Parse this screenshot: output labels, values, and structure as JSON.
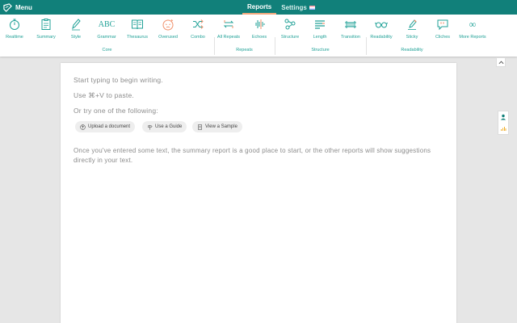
{
  "topbar": {
    "menu_label": "Menu",
    "tabs": [
      {
        "label": "Reports",
        "active": true
      },
      {
        "label": "Settings",
        "active": false
      }
    ]
  },
  "toolbar": {
    "tools": [
      {
        "label": "Realtime",
        "icon": "stopwatch-icon"
      },
      {
        "label": "Summary",
        "icon": "clipboard-icon"
      },
      {
        "label": "Style",
        "icon": "pen-icon"
      },
      {
        "label": "Grammar",
        "icon": "abc-icon",
        "glyph": "ABC"
      },
      {
        "label": "Thesaurus",
        "icon": "book-icon"
      },
      {
        "label": "Overused",
        "icon": "tired-face-icon"
      },
      {
        "label": "Combo",
        "icon": "shuffle-icon"
      },
      {
        "label": "All Repeats",
        "icon": "repeat-icon"
      },
      {
        "label": "Echoes",
        "icon": "sound-wave-icon"
      },
      {
        "label": "Structure",
        "icon": "structure-icon"
      },
      {
        "label": "Length",
        "icon": "length-icon"
      },
      {
        "label": "Transition",
        "icon": "bridge-icon"
      },
      {
        "label": "Readability",
        "icon": "glasses-icon"
      },
      {
        "label": "Sticky",
        "icon": "sticky-pen-icon"
      },
      {
        "label": "Cliches",
        "icon": "speech-bubble-icon"
      },
      {
        "label": "More Reports",
        "icon": "more-icon",
        "glyph": "∞"
      }
    ],
    "groups": [
      {
        "label": "Core"
      },
      {
        "label": "Repeats"
      },
      {
        "label": "Structure"
      },
      {
        "label": "Readability"
      }
    ]
  },
  "doc": {
    "line1": "Start typing to begin writing.",
    "line2": "Use ⌘+V to paste.",
    "line3": "Or try one of the following:",
    "buttons": [
      {
        "label": "Upload a document"
      },
      {
        "label": "Use a Guide"
      },
      {
        "label": "View a Sample"
      }
    ],
    "note": "Once you've entered some text, the summary report is a good place to start, or the other reports will show suggestions directly in your text."
  },
  "colors": {
    "primary": "#11807a",
    "accent": "#20a197",
    "underline": "#f2a97e",
    "placeholder": "#8c8c8c"
  }
}
